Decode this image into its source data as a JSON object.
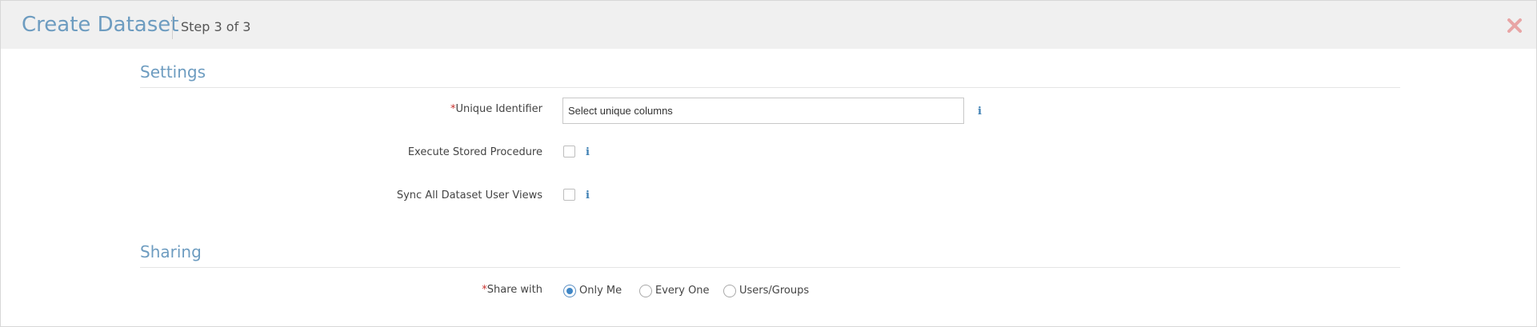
{
  "header": {
    "title": "Create Dataset",
    "step": "Step 3 of 3",
    "close_icon": "close-icon"
  },
  "settings": {
    "section_title": "Settings",
    "unique_identifier": {
      "required_mark": "*",
      "label": "Unique Identifier",
      "placeholder": "Select unique columns",
      "info_icon": "i"
    },
    "execute_stored_procedure": {
      "label": "Execute Stored Procedure",
      "checked": false,
      "info_icon": "i"
    },
    "sync_all_dataset_user_views": {
      "label": "Sync All Dataset User Views",
      "checked": false,
      "info_icon": "i"
    }
  },
  "sharing": {
    "section_title": "Sharing",
    "share_with": {
      "required_mark": "*",
      "label": "Share with",
      "options": [
        "Only Me",
        "Every One",
        "Users/Groups"
      ],
      "selected": "Only Me"
    }
  },
  "colors": {
    "title_blue": "#6d9cc0",
    "required_red": "#c9302c",
    "info_blue": "#3d7fb3",
    "close_red": "#e8a5a5",
    "header_bg": "#f0f0f0"
  }
}
